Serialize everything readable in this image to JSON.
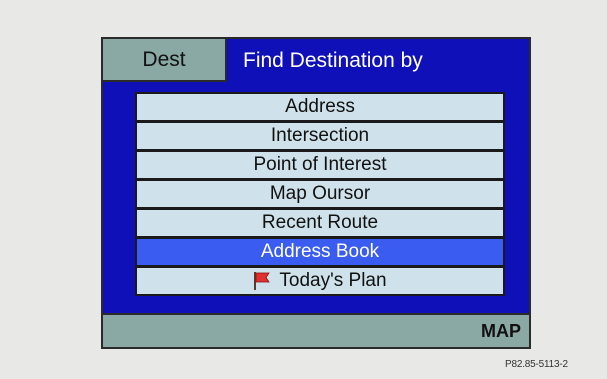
{
  "header": {
    "dest_tab_label": "Dest",
    "title": "Find Destination by"
  },
  "menu": {
    "items": [
      {
        "label": "Address",
        "selected": false
      },
      {
        "label": "Intersection",
        "selected": false
      },
      {
        "label": "Point of Interest",
        "selected": false
      },
      {
        "label": "Map Oursor",
        "selected": false
      },
      {
        "label": "Recent Route",
        "selected": false
      },
      {
        "label": "Address Book",
        "selected": true
      },
      {
        "label": "Today's Plan",
        "selected": false,
        "icon": "red-flag-icon"
      }
    ]
  },
  "footer": {
    "map_label": "MAP"
  },
  "reference_code": "P82.85-5113-2",
  "colors": {
    "screen_background": "#1010b8",
    "tab_background": "#8aa8a4",
    "menu_item_background": "#cfe1ea",
    "selected_background": "#3a5cf0",
    "flag": "#e03030"
  }
}
